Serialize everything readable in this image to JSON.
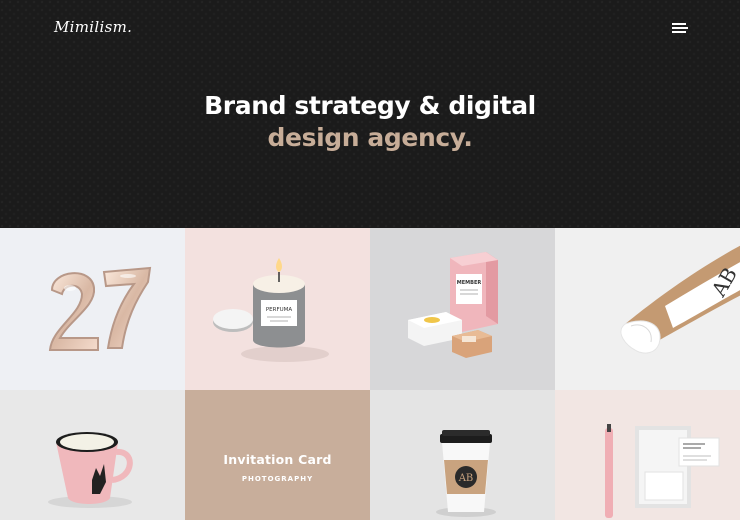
{
  "header": {
    "logo": "Mimilism.",
    "menu_icon": "hamburger-menu-icon"
  },
  "hero": {
    "line1": "Brand strategy & digital",
    "line2": "design agency.",
    "accent_color": "#c7ad98"
  },
  "portfolio": {
    "items": [
      {
        "image": "balloon-27"
      },
      {
        "image": "candle-jar"
      },
      {
        "image": "boxes-packaging"
      },
      {
        "image": "paper-roll"
      },
      {
        "image": "pink-mug"
      },
      {
        "title": "Invitation Card",
        "category": "PHOTOGRAPHY"
      },
      {
        "image": "coffee-cup"
      },
      {
        "image": "stationery-set"
      }
    ],
    "candle_label": "PERFUMA",
    "box_label": "MEMBER",
    "cup_monogram": "AB",
    "roll_monogram": "AB"
  }
}
